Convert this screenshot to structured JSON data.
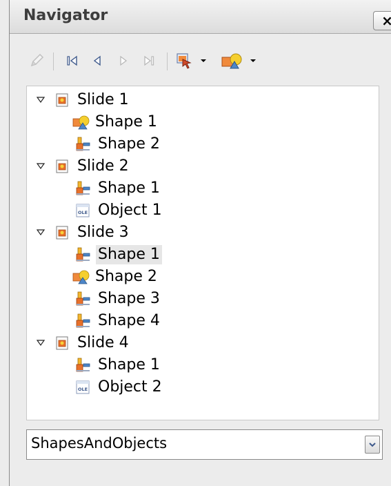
{
  "window": {
    "title": "Navigator",
    "close_label": "×"
  },
  "toolbar": {
    "items": [
      {
        "icon": "pencil-icon",
        "name": "edit"
      },
      {
        "icon": "first-icon",
        "name": "first-slide"
      },
      {
        "icon": "previous-icon",
        "name": "previous-slide"
      },
      {
        "icon": "next-icon",
        "name": "next-slide"
      },
      {
        "icon": "last-icon",
        "name": "last-slide"
      },
      {
        "icon": "drag-mode-icon",
        "name": "drag-mode",
        "dropdown": true
      },
      {
        "icon": "shapes-icon",
        "name": "show-shapes",
        "dropdown": true
      }
    ]
  },
  "tree": {
    "slides": [
      {
        "label": "Slide 1",
        "children": [
          {
            "label": "Shape 1",
            "icon": "shapes-icon"
          },
          {
            "label": "Shape 2",
            "icon": "object-shape-icon"
          }
        ]
      },
      {
        "label": "Slide 2",
        "children": [
          {
            "label": "Shape 1",
            "icon": "object-shape-icon"
          },
          {
            "label": "Object 1",
            "icon": "ole-object-icon"
          }
        ]
      },
      {
        "label": "Slide 3",
        "children": [
          {
            "label": "Shape 1",
            "icon": "object-shape-icon",
            "selected": true
          },
          {
            "label": "Shape 2",
            "icon": "shapes-icon"
          },
          {
            "label": "Shape 3",
            "icon": "object-shape-icon"
          },
          {
            "label": "Shape 4",
            "icon": "object-shape-icon"
          }
        ]
      },
      {
        "label": "Slide 4",
        "children": [
          {
            "label": "Shape 1",
            "icon": "object-shape-icon"
          },
          {
            "label": "Object 2",
            "icon": "ole-object-icon"
          }
        ]
      }
    ]
  },
  "document_select": {
    "value": "ShapesAndObjects"
  }
}
